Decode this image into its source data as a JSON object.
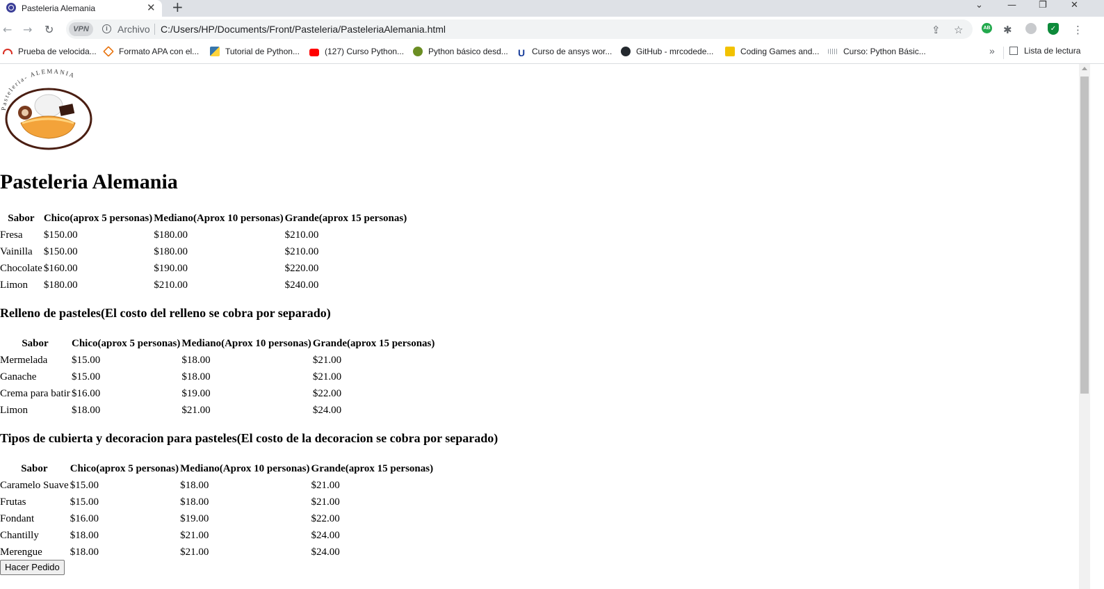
{
  "browser": {
    "tab_title": "Pasteleria Alemania",
    "tab_close": "✕",
    "new_tab": "+",
    "omnibox": {
      "vpn_label": "VPN",
      "security_label": "Archivo",
      "url": "C:/Users/HP/Documents/Front/Pasteleria/PasteleriaAlemania.html"
    },
    "extension_badge": "AB",
    "bookmarks": [
      {
        "label": "Prueba de velocida...",
        "icon": "speedometer-icon",
        "color": "#d93025"
      },
      {
        "label": "Formato APA con el...",
        "icon": "mortarboard-icon",
        "color": "#e8710a"
      },
      {
        "label": "Tutorial de Python...",
        "icon": "python-icon",
        "color": "#3776ab"
      },
      {
        "label": "(127) Curso Python...",
        "icon": "youtube-icon",
        "color": "#ff0000"
      },
      {
        "label": "Python básico desd...",
        "icon": "turtle-icon",
        "color": "#6b8e23"
      },
      {
        "label": "Curso de ansys wor...",
        "icon": "u-logo-icon",
        "color": "#1a3e9b"
      },
      {
        "label": "GitHub - mrcodede...",
        "icon": "github-icon",
        "color": "#24292e"
      },
      {
        "label": "Coding Games and...",
        "icon": "codingame-icon",
        "color": "#f2c200"
      },
      {
        "label": "Curso: Python Básic...",
        "icon": "cisco-icon",
        "color": "#9aa0a6"
      }
    ],
    "reading_list": "Lista de lectura"
  },
  "page": {
    "logo_text": "Pasteleria- ALEMANIA",
    "title": "Pasteleria Alemania",
    "headers": [
      "Sabor",
      "Chico(aprox 5 personas)",
      "Mediano(Aprox 10 personas)",
      "Grande(aprox 15 personas)"
    ],
    "cakes": {
      "rows": [
        [
          "Fresa",
          "$150.00",
          "$180.00",
          "$210.00"
        ],
        [
          "Vainilla",
          "$150.00",
          "$180.00",
          "$210.00"
        ],
        [
          "Chocolate",
          "$160.00",
          "$190.00",
          "$220.00"
        ],
        [
          "Limon",
          "$180.00",
          "$210.00",
          "$240.00"
        ]
      ]
    },
    "fillings": {
      "title": "Relleno de pasteles(El costo del relleno se cobra por separado)",
      "rows": [
        [
          "Mermelada",
          "$15.00",
          "$18.00",
          "$21.00"
        ],
        [
          "Ganache",
          "$15.00",
          "$18.00",
          "$21.00"
        ],
        [
          "Crema para batir",
          "$16.00",
          "$19.00",
          "$22.00"
        ],
        [
          "Limon",
          "$18.00",
          "$21.00",
          "$24.00"
        ]
      ]
    },
    "toppings": {
      "title": "Tipos de cubierta y decoracion para pasteles(El costo de la decoracion se cobra por separado)",
      "rows": [
        [
          "Caramelo Suave",
          "$15.00",
          "$18.00",
          "$21.00"
        ],
        [
          "Frutas",
          "$15.00",
          "$18.00",
          "$21.00"
        ],
        [
          "Fondant",
          "$16.00",
          "$19.00",
          "$22.00"
        ],
        [
          "Chantilly",
          "$18.00",
          "$21.00",
          "$24.00"
        ],
        [
          "Merengue",
          "$18.00",
          "$21.00",
          "$24.00"
        ]
      ]
    },
    "order_button": "Hacer Pedido"
  }
}
